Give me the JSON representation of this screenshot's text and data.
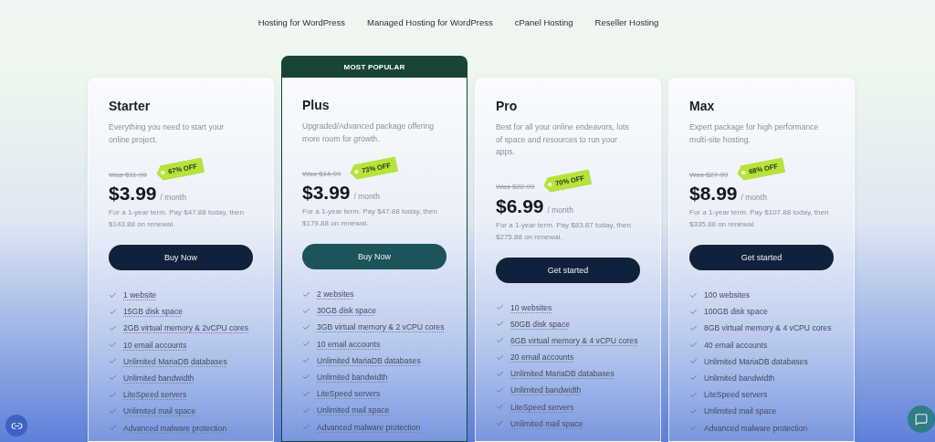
{
  "nav": [
    "Hosting for WordPress",
    "Managed Hosting for WordPress",
    "cPanel Hosting",
    "Reseller Hosting"
  ],
  "plans": [
    {
      "name": "Starter",
      "featured": false,
      "underlined": true,
      "description": "Everything you need to start your online project.",
      "was": "Was $11.99",
      "discount": "67% OFF",
      "price": "$3.99",
      "period": "/ month",
      "note": "For a 1-year term. Pay $47.88 today, then $143.88 on renewal.",
      "button": "Buy Now",
      "features": [
        "1 website",
        "15GB disk space",
        "2GB virtual memory & 2vCPU cores",
        "10 email accounts",
        "Unlimited MariaDB databases",
        "Unlimited bandwidth",
        "LiteSpeed servers",
        "Unlimited mail space",
        "Advanced malware protection"
      ]
    },
    {
      "name": "Plus",
      "featured": true,
      "badge": "MOST POPULAR",
      "underlined": true,
      "description": "Upgraded/Advanced package offering more room for growth.",
      "was": "Was $14.99",
      "discount": "73% OFF",
      "price": "$3.99",
      "period": "/ month",
      "note": "For a 1-year term. Pay $47.88 today, then $179.88 on renewal.",
      "button": "Buy Now",
      "features": [
        "2 websites",
        "30GB disk space",
        "3GB virtual memory & 2 vCPU cores",
        "10 email accounts",
        "Unlimited MariaDB databases",
        "Unlimited bandwidth",
        "LiteSpeed servers",
        "Unlimited mail space",
        "Advanced malware protection"
      ]
    },
    {
      "name": "Pro",
      "featured": false,
      "underlined": true,
      "description": "Best for all your online endeavors, lots of space and resources to run your apps.",
      "was": "Was $22.99",
      "discount": "70% OFF",
      "price": "$6.99",
      "period": "/ month",
      "note": "For a 1-year term. Pay $83.87 today, then $275.88 on renewal.",
      "button": "Get started",
      "features": [
        "10 websites",
        "50GB disk space",
        "6GB virtual memory & 4 vCPU cores",
        "20 email accounts",
        "Unlimited MariaDB databases",
        "Unlimited bandwidth",
        "LiteSpeed servers",
        "Unlimited mail space"
      ]
    },
    {
      "name": "Max",
      "featured": false,
      "underlined": false,
      "description": "Expert package for high performance multi-site hosting.",
      "was": "Was $27.99",
      "discount": "68% OFF",
      "price": "$8.99",
      "period": "/ month",
      "note": "For a 1-year term. Pay $107.88 today, then $335.88 on renewal.",
      "button": "Get started",
      "features": [
        "100 websites",
        "100GB disk space",
        "8GB virtual memory & 4 vCPU cores",
        "40 email accounts",
        "Unlimited MariaDB databases",
        "Unlimited bandwidth",
        "LiteSpeed servers",
        "Unlimited mail space",
        "Advanced malware protection"
      ]
    }
  ]
}
